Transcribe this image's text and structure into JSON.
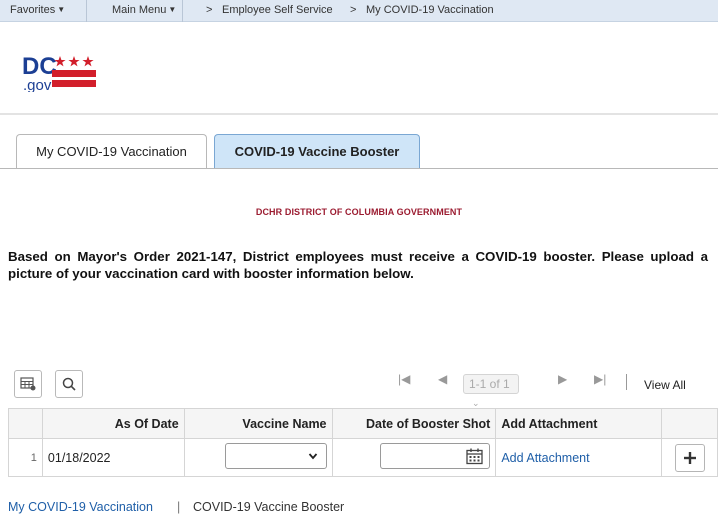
{
  "nav": {
    "favorites": "Favorites",
    "main_menu": "Main Menu",
    "crumb_sep": ">",
    "crumb1": "Employee Self Service",
    "crumb2": "My COVID-19 Vaccination"
  },
  "logo": {
    "text": "DC",
    "sub": ".gov"
  },
  "colors": {
    "dc_red": "#d21f2b",
    "link": "#1f5fa8",
    "active_tab": "#cfe5f8",
    "org_title": "#9b1b30"
  },
  "tabs": [
    {
      "label": "My COVID-19 Vaccination",
      "active": false
    },
    {
      "label": "COVID-19 Vaccine Booster",
      "active": true
    }
  ],
  "org_title": "DCHR DISTRICT OF COLUMBIA GOVERNMENT",
  "notice": "Based on Mayor's Order 2021-147, District employees must receive a COVID-19 booster. Please upload a picture of your vaccination card with booster information below.",
  "grid": {
    "pager_text": "1-1 of 1",
    "view_all": "View All",
    "columns": [
      "As Of Date",
      "Vaccine Name",
      "Date of Booster Shot",
      "Add Attachment"
    ],
    "rows": [
      {
        "num": "1",
        "as_of_date": "01/18/2022",
        "vaccine_name": "",
        "booster_date": "",
        "attachment_link": "Add Attachment"
      }
    ]
  },
  "footer": {
    "link1": "My COVID-19 Vaccination",
    "sep": "|",
    "link2": "COVID-19 Vaccine Booster"
  }
}
